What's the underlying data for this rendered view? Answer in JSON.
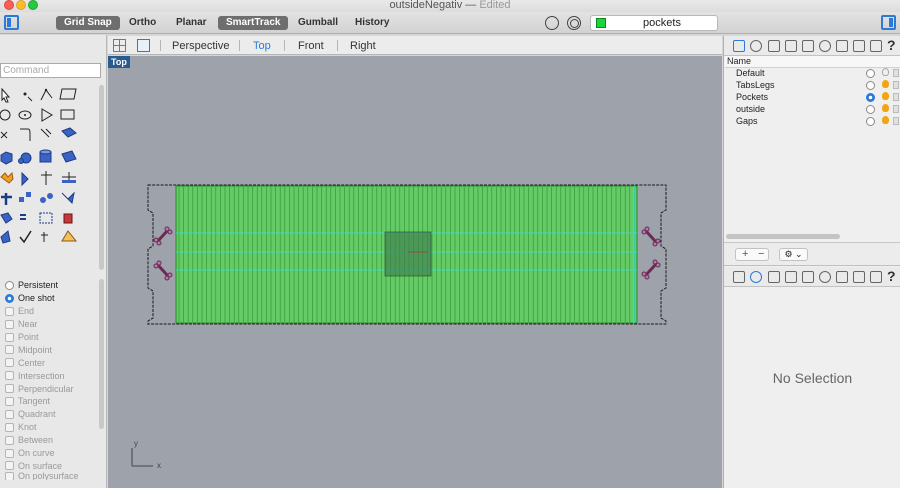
{
  "window": {
    "title": "outsideNegativ",
    "status": "Edited"
  },
  "toolbar": {
    "modes": [
      {
        "label": "Grid Snap",
        "active": true
      },
      {
        "label": "Ortho",
        "active": false
      },
      {
        "label": "Planar",
        "active": false
      },
      {
        "label": "SmartTrack",
        "active": true
      },
      {
        "label": "Gumball",
        "active": false
      },
      {
        "label": "History",
        "active": false
      }
    ],
    "current_layer": "pockets",
    "current_layer_color": "#1ed43c"
  },
  "command": {
    "placeholder": "Command"
  },
  "osnap": {
    "modes": [
      "Persistent",
      "One shot"
    ],
    "selected": "One shot",
    "items": [
      "End",
      "Near",
      "Point",
      "Midpoint",
      "Center",
      "Intersection",
      "Perpendicular",
      "Tangent",
      "Quadrant",
      "Knot",
      "Between",
      "On curve",
      "On surface",
      "On polysurface"
    ]
  },
  "viewport": {
    "tabs": [
      "Perspective",
      "Top",
      "Front",
      "Right"
    ],
    "active_tab": "Top",
    "label": "Top",
    "axis_y": "y",
    "axis_x": "x",
    "background": "#9da2ab"
  },
  "layers": {
    "column_header": "Name",
    "items": [
      {
        "name": "Default",
        "current": false,
        "visible": false
      },
      {
        "name": "TabsLegs",
        "current": false,
        "visible": true
      },
      {
        "name": "Pockets",
        "current": true,
        "visible": true
      },
      {
        "name": "outside",
        "current": false,
        "visible": true
      },
      {
        "name": "Gaps",
        "current": false,
        "visible": true
      }
    ],
    "add": "+",
    "remove": "−",
    "gear": "⚙ ⌄"
  },
  "properties": {
    "empty_text": "No Selection"
  }
}
